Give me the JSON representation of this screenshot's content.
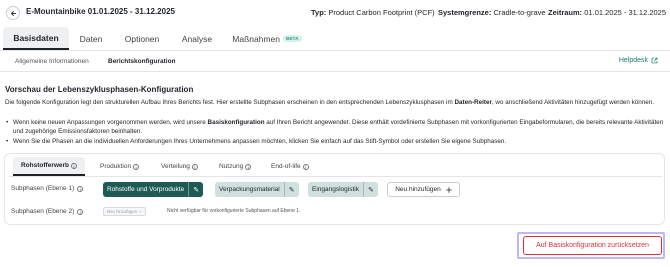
{
  "header": {
    "back_icon": "arrow-left-icon",
    "title": "E-Mountainbike 01.01.2025 - 31.12.2025",
    "typ_label": "Typ:",
    "typ_value": "Product Carbon Footprint (PCF)",
    "system_label": "Systemgrenze:",
    "system_value": "Cradle-to-grave",
    "zeitraum_label": "Zeitraum:",
    "zeitraum_value": "01.01.2025 - 31.12.2025"
  },
  "main_tabs": [
    {
      "label": "Basisdaten",
      "active": true
    },
    {
      "label": "Daten",
      "active": false
    },
    {
      "label": "Optionen",
      "active": false
    },
    {
      "label": "Analyse",
      "active": false
    },
    {
      "label": "Maßnahmen",
      "badge": "BETA",
      "active": false
    }
  ],
  "sub_tabs": [
    {
      "label": "Allgemeine Informationen",
      "active": false
    },
    {
      "label": "Berichtskonfiguration",
      "active": true
    }
  ],
  "helpdesk": {
    "label": "Helpdesk",
    "icon": "external-link-icon"
  },
  "section": {
    "title": "Vorschau der Lebenszyklusphasen-Konfiguration",
    "desc_part1": "Die folgende Konfiguration legt den strukturellen Aufbau Ihres Berichts fest. Hier erstellte Subphasen erscheinen in den entsprechenden Lebenszyklusphasen im ",
    "desc_bold": "Daten-Reiter",
    "desc_part2": ", wo anschließend Aktivitäten hinzugefügt werden können.",
    "bullet1_part1": "Wenn keine neuen Anpassungen vorgenommen werden, wird unsere ",
    "bullet1_bold": "Basiskonfiguration",
    "bullet1_part2": " auf Ihren Bericht angewendet. Diese enthält vordefinierte Subphasen mit vorkonfigurierten Eingabeformularen, die bereits relevante Aktivitäten und zugehörige Emissionsfaktoren beinhalten.",
    "bullet2": "Wenn Sie die Phasen an die individuellen Anforderungen Ihres Unternehmens anpassen möchten, klicken Sie einfach auf das Stift-Symbol oder erstellen Sie eigene Subphasen."
  },
  "phase_tabs": [
    {
      "label": "Rohstofferwerb",
      "active": true
    },
    {
      "label": "Produktion",
      "active": false
    },
    {
      "label": "Verteilung",
      "active": false
    },
    {
      "label": "Nutzung",
      "active": false
    },
    {
      "label": "End-of-life",
      "active": false
    }
  ],
  "level1": {
    "label": "Subphasen (Ebene 1)",
    "chips": [
      {
        "label": "Rohstoffe und Vorprodukte",
        "selected": true
      },
      {
        "label": "Verpackungsmaterial",
        "selected": false
      },
      {
        "label": "Eingangslogistik",
        "selected": false
      }
    ],
    "add_label": "Neu hinzufügen",
    "add_icon": "plus-icon"
  },
  "level2": {
    "label": "Subphasen (Ebene 2)",
    "add_label": "Neu hinzufügen",
    "note": "Nicht verfügbar für vorkonfigurierte Subphasen auf Ebene 1."
  },
  "reset_label": "Auf Basiskonfiguration zurücksetzen",
  "colors": {
    "accent": "#1e5b55",
    "chip_light": "#cfe0de",
    "danger": "#d8333b",
    "link": "#1a7a6e",
    "highlight": "#c2b7ec"
  }
}
